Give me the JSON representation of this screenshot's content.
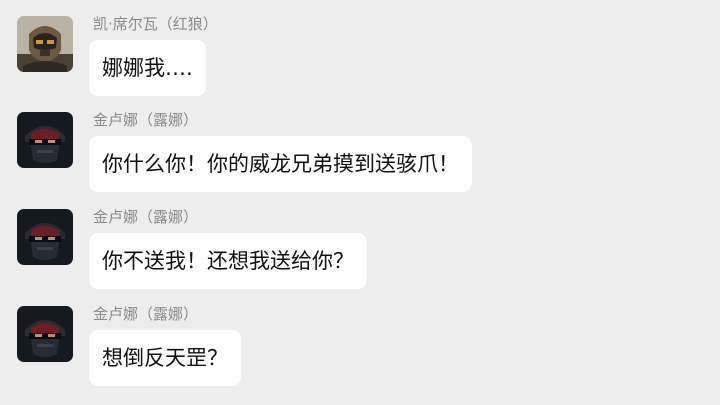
{
  "messages": [
    {
      "sender": "凯·席尔瓦（红狼）",
      "text": "娜娜我…."
    },
    {
      "sender": "金卢娜（露娜）",
      "text": "你什么你！你的威龙兄弟摸到送骇爪！"
    },
    {
      "sender": "金卢娜（露娜）",
      "text": "你不送我！还想我送给你？"
    },
    {
      "sender": "金卢娜（露娜）",
      "text": "想倒反天罡？"
    }
  ]
}
